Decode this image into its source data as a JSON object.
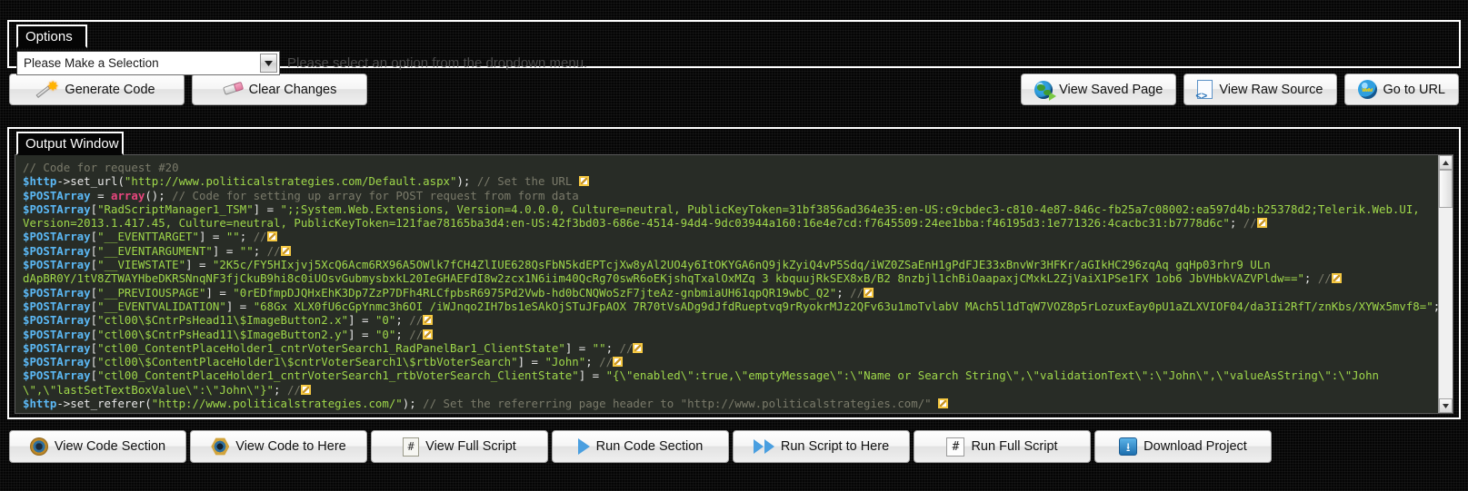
{
  "options": {
    "legend": "Options",
    "dropdown_value": "Please Make a Selection",
    "dropdown_options": [
      "Please Make a Selection"
    ],
    "hint": "Please select an option from the dropdown menu."
  },
  "top_actions": {
    "left": [
      {
        "label": "Generate Code",
        "icon": "wand-icon"
      },
      {
        "label": "Clear Changes",
        "icon": "eraser-icon"
      }
    ],
    "right": [
      {
        "label": "View Saved Page",
        "icon": "globe-arrow-icon"
      },
      {
        "label": "View Raw Source",
        "icon": "document-code-icon"
      },
      {
        "label": "Go to URL",
        "icon": "www-globe-icon"
      }
    ]
  },
  "output": {
    "legend": "Output Window",
    "code_lines": [
      [
        {
          "t": "cmt",
          "v": "// Code for request #20"
        }
      ],
      [
        {
          "t": "var",
          "v": "$http"
        },
        {
          "t": "op",
          "v": "->set_url("
        },
        {
          "t": "str",
          "v": "\"http://www.politicalstrategies.com/Default.aspx\""
        },
        {
          "t": "op",
          "v": "); "
        },
        {
          "t": "cmt",
          "v": "// Set the URL "
        },
        {
          "t": "pencil",
          "v": ""
        }
      ],
      [
        {
          "t": "var",
          "v": "$POSTArray"
        },
        {
          "t": "op",
          "v": " = "
        },
        {
          "t": "fn",
          "v": "array"
        },
        {
          "t": "op",
          "v": "(); "
        },
        {
          "t": "cmt",
          "v": "// Code for setting up array for POST request from form data"
        }
      ],
      [
        {
          "t": "var",
          "v": "$POSTArray"
        },
        {
          "t": "pun",
          "v": "["
        },
        {
          "t": "str",
          "v": "\"RadScriptManager1_TSM\""
        },
        {
          "t": "pun",
          "v": "]"
        },
        {
          "t": "op",
          "v": " = "
        },
        {
          "t": "str",
          "v": "\";;System.Web.Extensions, Version=4.0.0.0, Culture=neutral, PublicKeyToken=31bf3856ad364e35:en-US:c9cbdec3-c810-4e87-846c-fb25a7c08002:ea597d4b:b25378d2;Telerik.Web.UI,"
        }
      ],
      [
        {
          "t": "str",
          "v": "Version=2013.1.417.45, Culture=neutral, PublicKeyToken=121fae78165ba3d4:en-US:42f3bd03-686e-4514-94d4-9dc03944a160:16e4e7cd:f7645509:24ee1bba:f46195d3:1e771326:4cacbc31:b7778d6c\""
        },
        {
          "t": "op",
          "v": "; "
        },
        {
          "t": "cmt",
          "v": "//"
        },
        {
          "t": "pencil",
          "v": ""
        }
      ],
      [
        {
          "t": "var",
          "v": "$POSTArray"
        },
        {
          "t": "pun",
          "v": "["
        },
        {
          "t": "str",
          "v": "\"__EVENTTARGET\""
        },
        {
          "t": "pun",
          "v": "]"
        },
        {
          "t": "op",
          "v": " = "
        },
        {
          "t": "str",
          "v": "\"\""
        },
        {
          "t": "op",
          "v": "; "
        },
        {
          "t": "cmt",
          "v": "//"
        },
        {
          "t": "pencil",
          "v": ""
        }
      ],
      [
        {
          "t": "var",
          "v": "$POSTArray"
        },
        {
          "t": "pun",
          "v": "["
        },
        {
          "t": "str",
          "v": "\"__EVENTARGUMENT\""
        },
        {
          "t": "pun",
          "v": "]"
        },
        {
          "t": "op",
          "v": " = "
        },
        {
          "t": "str",
          "v": "\"\""
        },
        {
          "t": "op",
          "v": "; "
        },
        {
          "t": "cmt",
          "v": "//"
        },
        {
          "t": "pencil",
          "v": ""
        }
      ],
      [
        {
          "t": "var",
          "v": "$POSTArray"
        },
        {
          "t": "pun",
          "v": "["
        },
        {
          "t": "str",
          "v": "\"__VIEWSTATE\""
        },
        {
          "t": "pun",
          "v": "]"
        },
        {
          "t": "op",
          "v": " = "
        },
        {
          "t": "str",
          "v": "\"2K5c/FY5HIxjvj5XcQ6Acm6RX96A5OWlk7fCH4ZlIUE628QsFbN5kdEPTcjXw8yAl2UO4y6ItOKYGA6nQ9jkZyiQ4vP5Sdq/iWZ0ZSaEnH1gPdFJE33xBnvWr3HFKr/aGIkHC296zqAq gqHp03rhr9 ULn"
        }
      ],
      [
        {
          "t": "str",
          "v": "dApBR0Y/1tV8ZTWAYHbeDKRSNnqNF3fjCkuB9hi8c0iUOsvGubmysbxkL20IeGHAEFdI8w2zcx1N6iim40QcRg70swR6oEKjshqTxalOxMZq 3 kbquujRkSEX8xB/B2 8nzbjl1chBiOaapaxjCMxkL2ZjVaiX1PSe1FX 1ob6 JbVHbkVAZVPldw==\""
        },
        {
          "t": "op",
          "v": "; "
        },
        {
          "t": "cmt",
          "v": "//"
        },
        {
          "t": "pencil",
          "v": ""
        }
      ],
      [
        {
          "t": "var",
          "v": "$POSTArray"
        },
        {
          "t": "pun",
          "v": "["
        },
        {
          "t": "str",
          "v": "\"__PREVIOUSPAGE\""
        },
        {
          "t": "pun",
          "v": "]"
        },
        {
          "t": "op",
          "v": " = "
        },
        {
          "t": "str",
          "v": "\"0rEDfmpDJQHxEhK3Dp7ZzP7DFh4RLCfpbsR6975Pd2Vwb-hd0bCNQWoSzF7jteAz-gnbmiaUH61qpQR19wbC_Q2\""
        },
        {
          "t": "op",
          "v": "; "
        },
        {
          "t": "cmt",
          "v": "//"
        },
        {
          "t": "pencil",
          "v": ""
        }
      ],
      [
        {
          "t": "var",
          "v": "$POSTArray"
        },
        {
          "t": "pun",
          "v": "["
        },
        {
          "t": "str",
          "v": "\"__EVENTVALIDATION\""
        },
        {
          "t": "pun",
          "v": "]"
        },
        {
          "t": "op",
          "v": " = "
        },
        {
          "t": "str",
          "v": "\"68Gx XLX0fU6cGpYnmc3h6OI /iWJnqo2IH7bs1eSAkOjSTuJFpAOX 7R70tVsADg9dJfdRueptvq9rRyokrMJz2QFv63u1moTvlabV MAch5l1dTqW7VOZ8p5rLozuxEay0pU1aZLXVIOF04/da3Ii2RfT/znKbs/XYWx5mvf8=\""
        },
        {
          "t": "op",
          "v": "; "
        },
        {
          "t": "cmt",
          "v": "//"
        },
        {
          "t": "pencil",
          "v": ""
        }
      ],
      [
        {
          "t": "var",
          "v": "$POSTArray"
        },
        {
          "t": "pun",
          "v": "["
        },
        {
          "t": "str",
          "v": "\"ctl00\\$CntrPsHead11\\$ImageButton2.x\""
        },
        {
          "t": "pun",
          "v": "]"
        },
        {
          "t": "op",
          "v": " = "
        },
        {
          "t": "str",
          "v": "\"0\""
        },
        {
          "t": "op",
          "v": "; "
        },
        {
          "t": "cmt",
          "v": "//"
        },
        {
          "t": "pencil",
          "v": ""
        }
      ],
      [
        {
          "t": "var",
          "v": "$POSTArray"
        },
        {
          "t": "pun",
          "v": "["
        },
        {
          "t": "str",
          "v": "\"ctl00\\$CntrPsHead11\\$ImageButton2.y\""
        },
        {
          "t": "pun",
          "v": "]"
        },
        {
          "t": "op",
          "v": " = "
        },
        {
          "t": "str",
          "v": "\"0\""
        },
        {
          "t": "op",
          "v": "; "
        },
        {
          "t": "cmt",
          "v": "//"
        },
        {
          "t": "pencil",
          "v": ""
        }
      ],
      [
        {
          "t": "var",
          "v": "$POSTArray"
        },
        {
          "t": "pun",
          "v": "["
        },
        {
          "t": "str",
          "v": "\"ctl00_ContentPlaceHolder1_cntrVoterSearch1_RadPanelBar1_ClientState\""
        },
        {
          "t": "pun",
          "v": "]"
        },
        {
          "t": "op",
          "v": " = "
        },
        {
          "t": "str",
          "v": "\"\""
        },
        {
          "t": "op",
          "v": "; "
        },
        {
          "t": "cmt",
          "v": "//"
        },
        {
          "t": "pencil",
          "v": ""
        }
      ],
      [
        {
          "t": "var",
          "v": "$POSTArray"
        },
        {
          "t": "pun",
          "v": "["
        },
        {
          "t": "str",
          "v": "\"ctl00\\$ContentPlaceHolder1\\$cntrVoterSearch1\\$rtbVoterSearch\""
        },
        {
          "t": "pun",
          "v": "]"
        },
        {
          "t": "op",
          "v": " = "
        },
        {
          "t": "str",
          "v": "\"John\""
        },
        {
          "t": "op",
          "v": "; "
        },
        {
          "t": "cmt",
          "v": "//"
        },
        {
          "t": "pencil",
          "v": ""
        }
      ],
      [
        {
          "t": "var",
          "v": "$POSTArray"
        },
        {
          "t": "pun",
          "v": "["
        },
        {
          "t": "str",
          "v": "\"ctl00_ContentPlaceHolder1_cntrVoterSearch1_rtbVoterSearch_ClientState\""
        },
        {
          "t": "pun",
          "v": "]"
        },
        {
          "t": "op",
          "v": " = "
        },
        {
          "t": "str",
          "v": "\"{\\\"enabled\\\":true,\\\"emptyMessage\\\":\\\"Name or Search String\\\",\\\"validationText\\\":\\\"John\\\",\\\"valueAsString\\\":\\\"John"
        }
      ],
      [
        {
          "t": "str",
          "v": "\\\",\\\"lastSetTextBoxValue\\\":\\\"John\\\"}\""
        },
        {
          "t": "op",
          "v": "; "
        },
        {
          "t": "cmt",
          "v": "//"
        },
        {
          "t": "pencil",
          "v": ""
        }
      ],
      [
        {
          "t": "var",
          "v": "$http"
        },
        {
          "t": "op",
          "v": "->set_referer("
        },
        {
          "t": "str",
          "v": "\"http://www.politicalstrategies.com/\""
        },
        {
          "t": "op",
          "v": "); "
        },
        {
          "t": "cmt",
          "v": "// Set the refererring page header to \"http://www.politicalstrategies.com/\" "
        },
        {
          "t": "pencil",
          "v": ""
        }
      ]
    ]
  },
  "bottom_actions": [
    {
      "label": "View Code Section",
      "icon": "eye-icon"
    },
    {
      "label": "View Code to Here",
      "icon": "eye-hex-icon"
    },
    {
      "label": "View Full Script",
      "icon": "script-hash-icon"
    },
    {
      "label": "Run Code Section",
      "icon": "play-icon"
    },
    {
      "label": "Run Script to Here",
      "icon": "play-double-icon"
    },
    {
      "label": "Run Full Script",
      "icon": "hash-icon"
    },
    {
      "label": "Download Project",
      "icon": "download-icon"
    }
  ],
  "colors": {
    "background": "#050505",
    "code_background": "#282c26",
    "code_string": "#9fd84a",
    "code_variable": "#5bb8f5",
    "code_comment": "#7a7a6a",
    "code_function": "#e8467e",
    "border": "#ffffff"
  }
}
